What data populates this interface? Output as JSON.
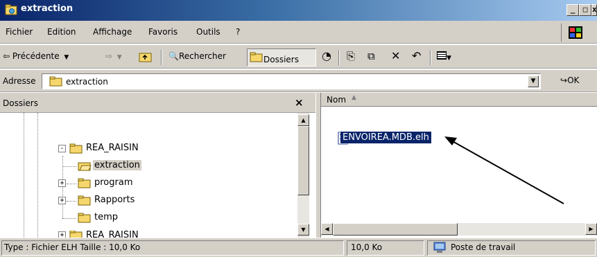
{
  "window": {
    "title": "extraction",
    "buttons": {
      "minimize": "_",
      "maximize": "□",
      "close": "x"
    }
  },
  "menu": [
    "Fichier",
    "Edition",
    "Affichage",
    "Favoris",
    "Outils",
    "?"
  ],
  "toolbar": {
    "back": "Précédente",
    "search": "Rechercher",
    "folders": "Dossiers"
  },
  "address": {
    "label": "Adresse",
    "value": "extraction",
    "go": "OK"
  },
  "folders_pane": {
    "title": "Dossiers",
    "close": "×",
    "tree": [
      {
        "label": "REA_RAISIN",
        "expander": "-"
      },
      {
        "label": "extraction",
        "selected": true
      },
      {
        "label": "program",
        "expander": "+"
      },
      {
        "label": "Rapports",
        "expander": "+"
      },
      {
        "label": "temp"
      },
      {
        "label": "REA_RAISIN",
        "expander": "+"
      }
    ]
  },
  "files_pane": {
    "column_name": "Nom",
    "sort_indicator": "▲",
    "files": [
      {
        "name": "ENVOIREA.MDB.elh",
        "selected": true
      }
    ]
  },
  "status": {
    "info": "Type : Fichier ELH Taille : 10,0 Ko",
    "size": "10,0 Ko",
    "location": "Poste de travail"
  },
  "colors": {
    "titlebar_start": "#0a246a",
    "titlebar_end": "#a6caf0",
    "selection": "#0a246a",
    "chrome": "#d4d0c8"
  }
}
